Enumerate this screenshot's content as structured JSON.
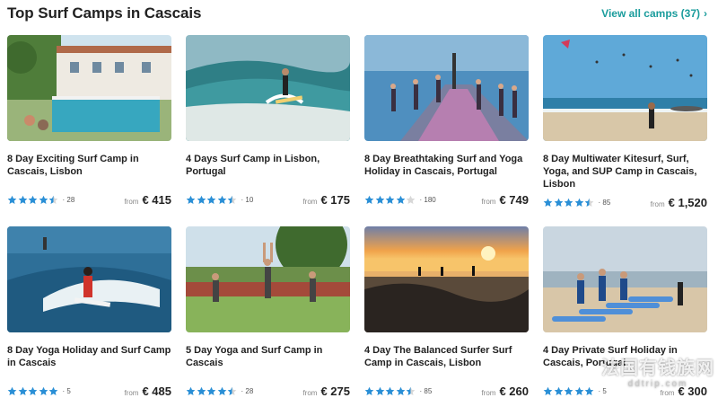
{
  "header": {
    "title": "Top Surf Camps in Cascais",
    "view_all": "View all camps (37)"
  },
  "colors": {
    "accent": "#1a9c9c",
    "star": "#2a8fd6",
    "star_empty": "#d7d7d7"
  },
  "cards": [
    {
      "title": "8 Day Exciting Surf Camp in Cascais, Lisbon",
      "rating": 4.5,
      "reviews": "· 28",
      "from": "from",
      "price": "€ 415",
      "image": "villa-pool"
    },
    {
      "title": "4 Days Surf Camp in Lisbon, Portugal",
      "rating": 4.5,
      "reviews": "· 10",
      "from": "from",
      "price": "€ 175",
      "image": "surfer-wave"
    },
    {
      "title": "8 Day Breathtaking Surf and Yoga Holiday in Cascais, Portugal",
      "rating": 4.0,
      "reviews": "· 180",
      "from": "from",
      "price": "€ 749",
      "image": "yoga-pier"
    },
    {
      "title": "8 Day Multiwater Kitesurf, Surf, Yoga, and SUP Camp in Cascais, Lisbon",
      "rating": 4.5,
      "reviews": "· 85",
      "from": "from",
      "price": "€ 1,520",
      "image": "kite-beach"
    },
    {
      "title": "8 Day Yoga Holiday and Surf Camp in Cascais",
      "rating": 5.0,
      "reviews": "· 5",
      "from": "from",
      "price": "€ 485",
      "image": "surfer-red"
    },
    {
      "title": "5 Day Yoga and Surf Camp in Cascais",
      "rating": 4.5,
      "reviews": "· 28",
      "from": "from",
      "price": "€ 275",
      "image": "yoga-garden"
    },
    {
      "title": "4 Day The Balanced Surfer Surf Camp in Cascais, Lisbon",
      "rating": 4.5,
      "reviews": "· 85",
      "from": "from",
      "price": "€ 260",
      "image": "sunset-rocks"
    },
    {
      "title": "4 Day Private Surf Holiday in Cascais, Portugal",
      "rating": 5.0,
      "reviews": "· 5",
      "from": "from",
      "price": "€ 300",
      "image": "surf-lesson"
    }
  ],
  "watermark": {
    "line1": "法国有钱族网",
    "line2": "ddtrip.com"
  }
}
